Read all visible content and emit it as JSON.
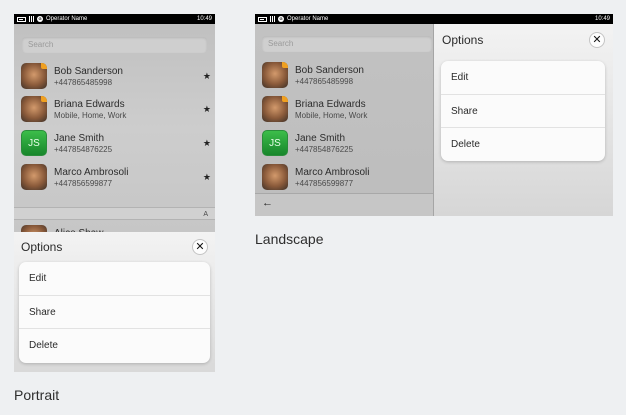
{
  "statusbar": {
    "operator": "Operator Name",
    "time": "10:49"
  },
  "search": {
    "placeholder": "Search"
  },
  "contacts": [
    {
      "name": "Bob Sanderson",
      "detail": "+447865485998",
      "starred": true
    },
    {
      "name": "Briana Edwards",
      "detail": "Mobile, Home, Work",
      "starred": true
    },
    {
      "name": "Jane Smith",
      "detail": "+447854876225",
      "starred": true,
      "initials": "JS"
    },
    {
      "name": "Marco Ambrosoli",
      "detail": "+447856599877",
      "starred": true
    }
  ],
  "section_letter": "A",
  "partial_contact": {
    "name": "Alice Shaw"
  },
  "star_glyph": "★",
  "options": {
    "title": "Options",
    "close_glyph": "✕",
    "items": [
      "Edit",
      "Share",
      "Delete"
    ]
  },
  "back_glyph": "←",
  "captions": {
    "portrait": "Portrait",
    "landscape": "Landscape"
  },
  "colors": {
    "accent_green": "#2fa23f",
    "background": "#eef0f2"
  }
}
